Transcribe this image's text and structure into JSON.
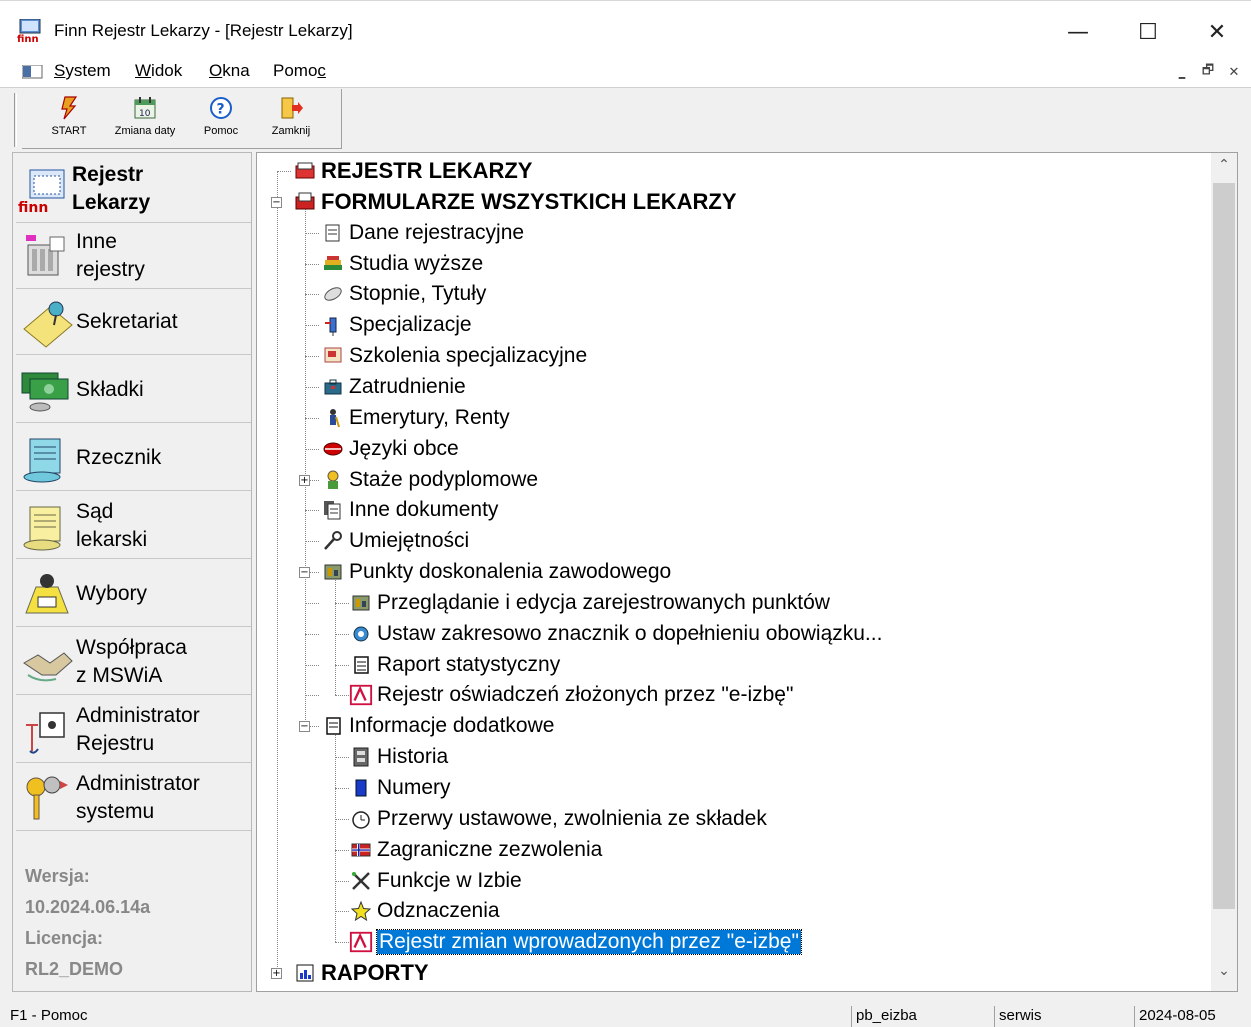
{
  "window": {
    "title": "Finn Rejestr Lekarzy - [Rejestr Lekarzy]",
    "minimize": "—",
    "maximize": "☐",
    "close": "✕"
  },
  "menu": {
    "items": [
      "System",
      "Widok",
      "Okna",
      "Pomoc"
    ],
    "mdi": [
      "_",
      "ɐ",
      "x"
    ]
  },
  "toolbar": {
    "buttons": [
      {
        "label": "START",
        "icon": "lightning-icon"
      },
      {
        "label": "Zmiana daty",
        "icon": "calendar-icon"
      },
      {
        "label": "Pomoc",
        "icon": "help-icon"
      },
      {
        "label": "Zamknij",
        "icon": "exit-icon"
      }
    ]
  },
  "nav": {
    "header": {
      "line1": "Rejestr",
      "line2": "Lekarzy"
    },
    "items": [
      {
        "line1": "Inne",
        "line2": "rejestry"
      },
      {
        "line1": "Sekretariat",
        "line2": ""
      },
      {
        "line1": "Składki",
        "line2": ""
      },
      {
        "line1": "Rzecznik",
        "line2": ""
      },
      {
        "line1": "Sąd",
        "line2": "lekarski"
      },
      {
        "line1": "Wybory",
        "line2": ""
      },
      {
        "line1": "Współpraca",
        "line2": "z MSWiA"
      },
      {
        "line1": "Administrator",
        "line2": "Rejestru"
      },
      {
        "line1": "Administrator",
        "line2": "systemu"
      }
    ],
    "version_label": "Wersja:",
    "version_value": "10.2024.06.14a",
    "license_label": "Licencja:",
    "license_value": "RL2_DEMO"
  },
  "tree": {
    "root1": "REJESTR LEKARZY",
    "root2": "FORMULARZE WSZYSTKICH LEKARZY",
    "items": [
      "Dane rejestracyjne",
      "Studia wyższe",
      "Stopnie, Tytuły",
      "Specjalizacje",
      "Szkolenia specjalizacyjne",
      "Zatrudnienie",
      "Emerytury, Renty",
      "Języki obce",
      "Staże podyplomowe",
      "Inne dokumenty",
      "Umiejętności",
      "Punkty doskonalenia zawodowego"
    ],
    "punkty_children": [
      "Przeglądanie i edycja zarejestrowanych punktów",
      "Ustaw zakresowo znacznik o dopełnieniu obowiązku...",
      "Raport statystyczny",
      "Rejestr oświadczeń złożonych przez \"e-izbę\""
    ],
    "info": "Informacje dodatkowe",
    "info_children": [
      "Historia",
      "Numery",
      "Przerwy ustawowe, zwolnienia ze składek",
      "Zagraniczne zezwolenia",
      "Funkcje w Izbie",
      "Odznaczenia",
      "Rejestr zmian wprowadzonych przez \"e-izbę\""
    ],
    "root3": "RAPORTY"
  },
  "status": {
    "help": "F1 - Pomoc",
    "db": "pb_eizba",
    "user": "serwis",
    "date": "2024-08-05"
  },
  "colors": {
    "selection": "#0078d7",
    "background": "#f0f0f0"
  }
}
